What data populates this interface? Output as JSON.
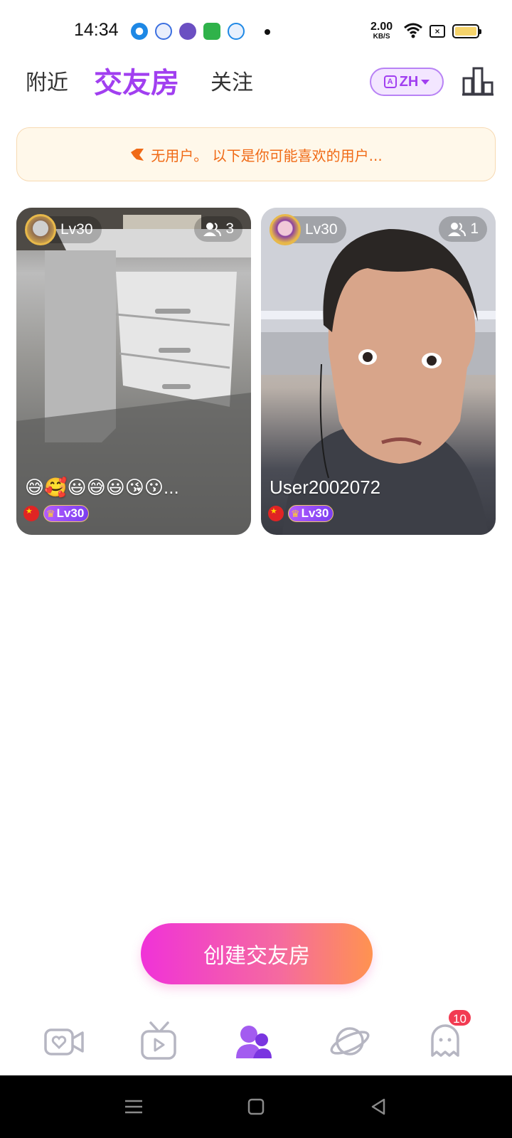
{
  "status_bar": {
    "time": "14:34",
    "net_speed_value": "2.00",
    "net_speed_unit": "KB/S",
    "notification_icons": [
      "camera-icon",
      "baidu-icon",
      "purple-app-icon",
      "android-app-icon",
      "q-app-icon"
    ],
    "battery_level": 0.9
  },
  "top_nav": {
    "tabs": [
      "附近",
      "交友房",
      "关注"
    ],
    "active_tab": "交友房",
    "language_label": "ZH"
  },
  "notice": {
    "text": "无用户。 以下是你可能喜欢的用户..."
  },
  "rooms": [
    {
      "level": "Lv30",
      "viewers": "3",
      "title": "😅🥰😃😅😃😘😗...",
      "host_level": "Lv30"
    },
    {
      "level": "Lv30",
      "viewers": "1",
      "title": "User2002072",
      "host_level": "Lv30"
    }
  ],
  "cta": {
    "label": "创建交友房"
  },
  "bottom_nav": {
    "items": [
      "video-heart-icon",
      "tv-play-icon",
      "friends-room-icon",
      "planet-icon",
      "ghost-message-icon"
    ],
    "active_item": "friends-room-icon",
    "message_badge": "10"
  },
  "colors": {
    "accent": "#a13ff0",
    "notice_text": "#f06a16",
    "notice_bg": "#fff8ea",
    "cta_start": "#f032d8",
    "cta_end": "#ff9350",
    "badge": "#f23b52"
  }
}
